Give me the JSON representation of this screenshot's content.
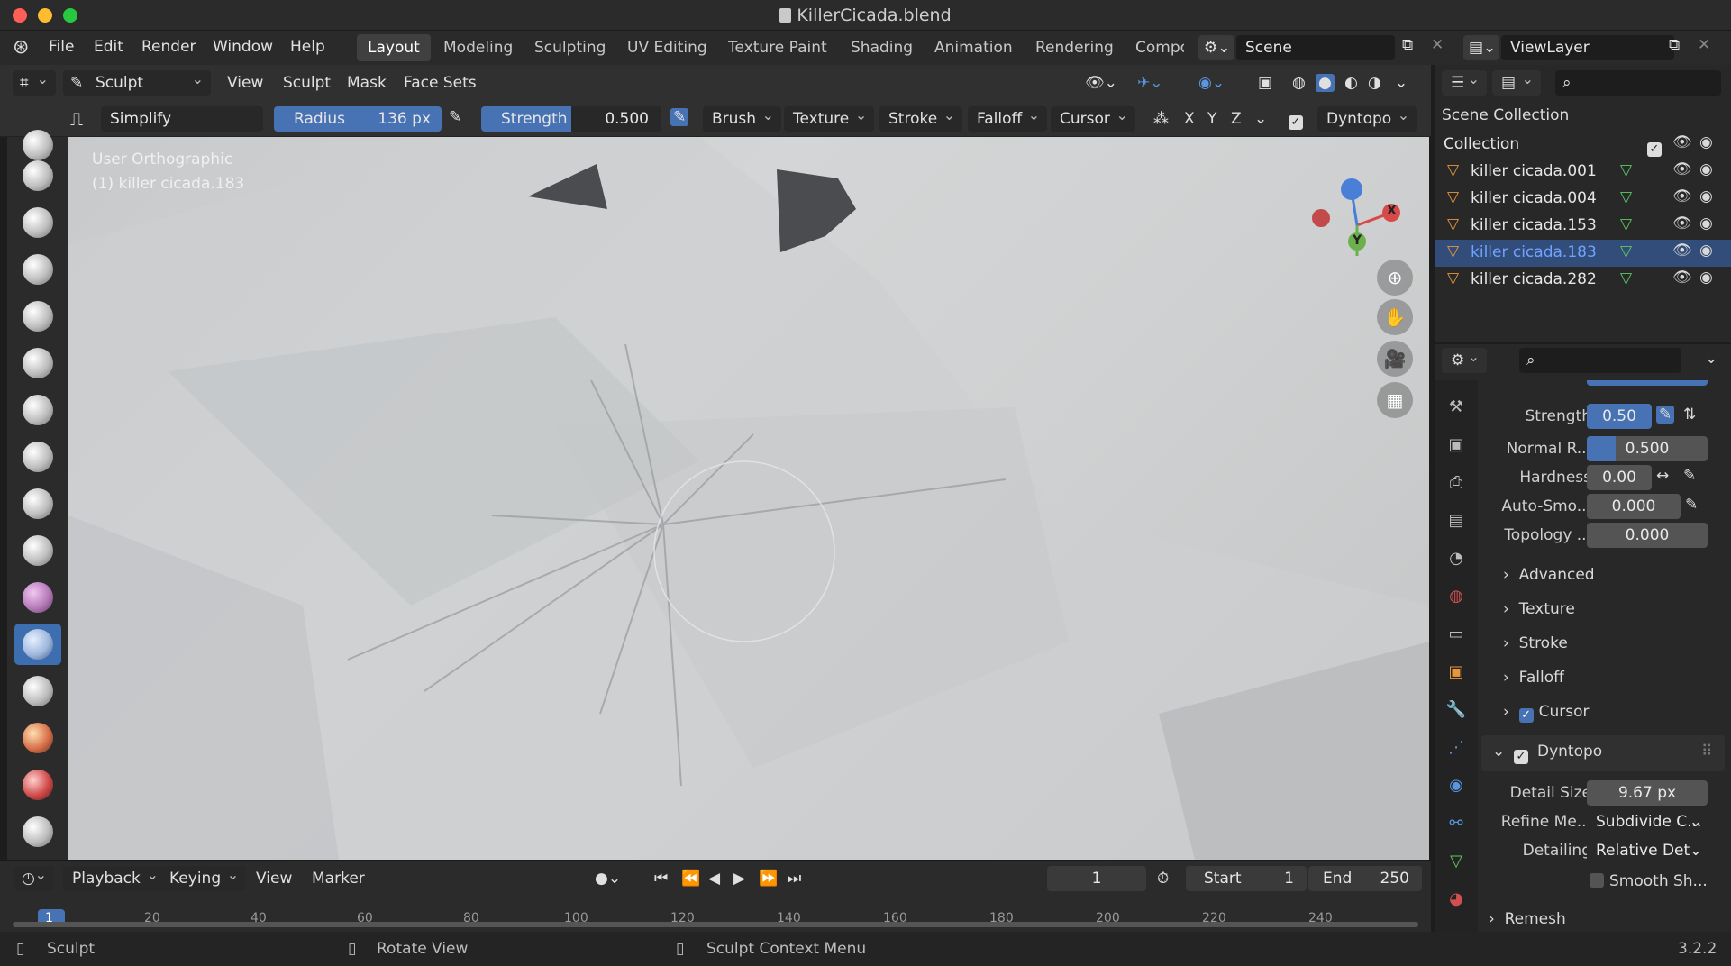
{
  "window": {
    "title": "KillerCicada.blend"
  },
  "menubar": {
    "items": [
      "File",
      "Edit",
      "Render",
      "Window",
      "Help"
    ]
  },
  "workspaces": [
    "Layout",
    "Modeling",
    "Sculpting",
    "UV Editing",
    "Texture Paint",
    "Shading",
    "Animation",
    "Rendering",
    "Compo"
  ],
  "scene": {
    "name": "Scene",
    "view_layer": "ViewLayer"
  },
  "header": {
    "mode": "Sculpt Mode",
    "menus": [
      "View",
      "Sculpt",
      "Mask",
      "Face Sets"
    ]
  },
  "tool_settings": {
    "tool_name": "Simplify",
    "radius_label": "Radius",
    "radius_value": "136 px",
    "strength_label": "Strength",
    "strength_value": "0.500",
    "dropdowns": [
      "Brush",
      "Texture",
      "Stroke",
      "Falloff",
      "Cursor"
    ],
    "axes": [
      "X",
      "Y",
      "Z"
    ],
    "dyntopo": "Dyntopo"
  },
  "viewport": {
    "view_name": "User Orthographic",
    "object_info": "(1) killer cicada.183",
    "gizmo": {
      "x": "X",
      "y": "Y"
    }
  },
  "outliner": {
    "header": "Scene Collection",
    "collection": "Collection",
    "items": [
      {
        "name": "killer cicada.001",
        "selected": false
      },
      {
        "name": "killer cicada.004",
        "selected": false
      },
      {
        "name": "killer cicada.153",
        "selected": false
      },
      {
        "name": "killer cicada.183",
        "selected": true
      },
      {
        "name": "killer cicada.282",
        "selected": false
      }
    ]
  },
  "properties": {
    "strength_label": "Strength",
    "strength_value": "0.50",
    "normal_label": "Normal R...",
    "normal_value": "0.500",
    "hardness_label": "Hardness",
    "hardness_value": "0.00",
    "autosmooth_label": "Auto-Smo...",
    "autosmooth_value": "0.000",
    "topology_label": "Topology ...",
    "topology_value": "0.000",
    "panels": [
      "Advanced",
      "Texture",
      "Stroke",
      "Falloff"
    ],
    "cursor_panel": "Cursor",
    "dyntopo_panel": "Dyntopo",
    "detail_size_label": "Detail Size",
    "detail_size_value": "9.67 px",
    "refine_label": "Refine Me...",
    "refine_value": "Subdivide C...",
    "detailing_label": "Detailing",
    "detailing_value": "Relative Det",
    "smooth_label": "Smooth Sh...",
    "remesh_label": "Remesh"
  },
  "timeline": {
    "menus": [
      "Playback",
      "Keying",
      "View",
      "Marker"
    ],
    "current_frame": "1",
    "start_label": "Start",
    "start_value": "1",
    "end_label": "End",
    "end_value": "250",
    "ticks": [
      "1",
      "20",
      "40",
      "60",
      "80",
      "100",
      "120",
      "140",
      "160",
      "180",
      "200",
      "220",
      "240"
    ]
  },
  "statusbar": {
    "left": "Sculpt",
    "middle": "Rotate View",
    "right": "Sculpt Context Menu",
    "version": "3.2.2"
  },
  "colors": {
    "accent": "#4772b3",
    "selected_text": "#6fa3ff",
    "close": "#ff5f57",
    "minimize": "#febc2e",
    "zoom": "#28c840"
  }
}
